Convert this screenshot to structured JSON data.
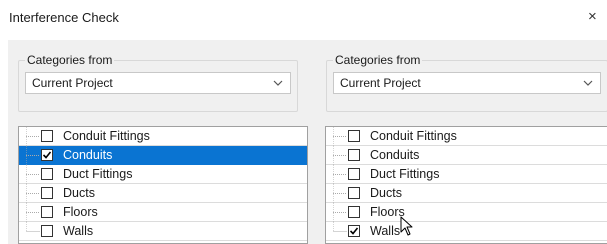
{
  "window": {
    "title": "Interference Check",
    "close_glyph": "×"
  },
  "left": {
    "group_label": "Categories from",
    "source_value": "Current Project",
    "selected_index": 1,
    "items": [
      {
        "label": "Conduit Fittings",
        "checked": false
      },
      {
        "label": "Conduits",
        "checked": true
      },
      {
        "label": "Duct Fittings",
        "checked": false
      },
      {
        "label": "Ducts",
        "checked": false
      },
      {
        "label": "Floors",
        "checked": false
      },
      {
        "label": "Walls",
        "checked": false
      }
    ]
  },
  "right": {
    "group_label": "Categories from",
    "source_value": "Current Project",
    "selected_index": -1,
    "items": [
      {
        "label": "Conduit Fittings",
        "checked": false
      },
      {
        "label": "Conduits",
        "checked": false
      },
      {
        "label": "Duct Fittings",
        "checked": false
      },
      {
        "label": "Ducts",
        "checked": false
      },
      {
        "label": "Floors",
        "checked": false
      },
      {
        "label": "Walls",
        "checked": true
      }
    ]
  },
  "icons": {
    "dropdown": "chevron-down-icon",
    "check": "checkmark-icon",
    "pointer": "mouse-pointer-icon"
  }
}
